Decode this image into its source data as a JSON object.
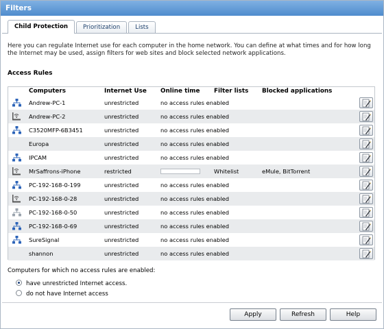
{
  "window": {
    "title": "Filters"
  },
  "tabs": [
    {
      "label": "Child Protection",
      "active": true
    },
    {
      "label": "Prioritization",
      "active": false
    },
    {
      "label": "Lists",
      "active": false
    }
  ],
  "intro_text": "Here you can regulate Internet use for each computer in the home network. You can define at what times and for how long the Internet may be used, assign filters for web sites and block selected network applications.",
  "access_rules": {
    "heading": "Access Rules",
    "columns": {
      "computers": "Computers",
      "internet_use": "Internet Use",
      "online_time": "Online time",
      "filter_lists": "Filter lists",
      "blocked_apps": "Blocked applications"
    },
    "rows": [
      {
        "icon": "network-lan-icon",
        "name": "Andrew-PC-1",
        "internet_use": "unrestricted",
        "online_time": "no access rules enabled",
        "filter_lists": "",
        "blocked_apps": ""
      },
      {
        "icon": "wireless-device-icon",
        "name": "Andrew-PC-2",
        "internet_use": "unrestricted",
        "online_time": "no access rules enabled",
        "filter_lists": "",
        "blocked_apps": ""
      },
      {
        "icon": "network-lan-icon",
        "name": "C3520MFP-6B3451",
        "internet_use": "unrestricted",
        "online_time": "no access rules enabled",
        "filter_lists": "",
        "blocked_apps": ""
      },
      {
        "icon": "",
        "name": "Europa",
        "internet_use": "unrestricted",
        "online_time": "no access rules enabled",
        "filter_lists": "",
        "blocked_apps": ""
      },
      {
        "icon": "network-lan-icon",
        "name": "IPCAM",
        "internet_use": "unrestricted",
        "online_time": "no access rules enabled",
        "filter_lists": "",
        "blocked_apps": ""
      },
      {
        "icon": "wireless-device-icon",
        "name": "MrSaffrons-iPhone",
        "internet_use": "restricted",
        "online_time": "",
        "online_time_progress": 0,
        "filter_lists": "Whitelist",
        "blocked_apps": "eMule, BitTorrent"
      },
      {
        "icon": "network-lan-icon",
        "name": "PC-192-168-0-199",
        "internet_use": "unrestricted",
        "online_time": "no access rules enabled",
        "filter_lists": "",
        "blocked_apps": ""
      },
      {
        "icon": "wireless-device-icon",
        "name": "PC-192-168-0-28",
        "internet_use": "unrestricted",
        "online_time": "no access rules enabled",
        "filter_lists": "",
        "blocked_apps": ""
      },
      {
        "icon": "network-lan-inactive-icon",
        "name": "PC-192-168-0-50",
        "internet_use": "unrestricted",
        "online_time": "no access rules enabled",
        "filter_lists": "",
        "blocked_apps": ""
      },
      {
        "icon": "network-lan-icon",
        "name": "PC-192-168-0-69",
        "internet_use": "unrestricted",
        "online_time": "no access rules enabled",
        "filter_lists": "",
        "blocked_apps": ""
      },
      {
        "icon": "network-lan-icon",
        "name": "SureSignal",
        "internet_use": "unrestricted",
        "online_time": "no access rules enabled",
        "filter_lists": "",
        "blocked_apps": ""
      },
      {
        "icon": "",
        "name": "shannon",
        "internet_use": "unrestricted",
        "online_time": "no access rules enabled",
        "filter_lists": "",
        "blocked_apps": ""
      }
    ],
    "edit_icon": "edit-icon"
  },
  "no_rule_options": {
    "label": "Computers for which no access rules are enabled:",
    "options": [
      {
        "label": "have unrestricted Internet access.",
        "checked": true
      },
      {
        "label": "do not have Internet access",
        "checked": false
      }
    ]
  },
  "buttons": {
    "apply": "Apply",
    "refresh": "Refresh",
    "help": "Help"
  },
  "colors": {
    "title_bar": "#4f8ccd",
    "row_alt": "#e9ebed",
    "icon_blue": "#2b63b8"
  }
}
